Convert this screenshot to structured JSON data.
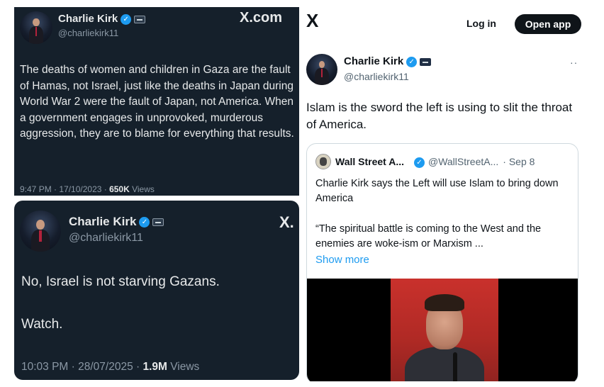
{
  "tweet1": {
    "name": "Charlie Kirk",
    "handle": "@charliekirk11",
    "site_label": "X.com",
    "text": "The deaths of women and children in Gaza are the fault of Hamas, not Israel, just like the deaths in Japan during World War 2 were the fault of Japan, not America. When a government engages in unprovoked, murderous aggression, they are to blame for everything that results.",
    "time_date": "9:47 PM · 17/10/2023 · ",
    "views_count": "650K",
    "views_label": " Views"
  },
  "tweet2": {
    "name": "Charlie Kirk",
    "handle": "@charliekirk11",
    "x_logo": "X.",
    "line1": "No, Israel is not starving Gazans.",
    "line2": "Watch.",
    "time_date": "10:03 PM · 28/07/2025 · ",
    "views_count": "1.9M",
    "views_label": " Views"
  },
  "right": {
    "x_logo": "X",
    "login_label": "Log in",
    "open_app_label": "Open app",
    "more_label": "··",
    "name": "Charlie Kirk",
    "handle": "@charliekirk11",
    "text": "Islam is the sword the left is using to slit the throat of America.",
    "quote": {
      "name": "Wall Street A...",
      "handle": "@WallStreetA...",
      "date": "· Sep 8",
      "line1": "Charlie Kirk says the Left will use Islam to bring down America",
      "line2": "“The spiritual battle is coming to the West and the enemies are woke-ism or Marxism ...",
      "show_more": "Show more"
    }
  },
  "icons": {
    "verified": "verified-badge-icon",
    "affiliation": "affiliation-badge-icon",
    "x": "x-logo-icon"
  },
  "colors": {
    "dark_bg": "#15202b",
    "verified_blue": "#1d9bf0",
    "link_blue": "#1d9bf0"
  }
}
